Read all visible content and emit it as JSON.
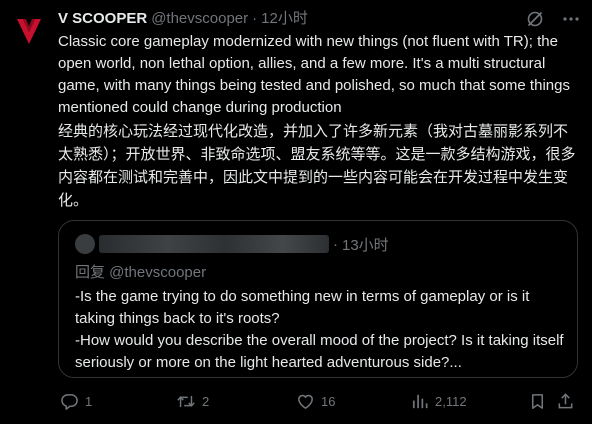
{
  "tweet": {
    "author_name": "V SCOOPER",
    "author_handle": "@thevscooper",
    "separator": "·",
    "timestamp": "12小时",
    "body_en": "Classic core gameplay modernized with new things (not fluent with TR); the open world, non lethal option, allies, and a few more. It's a multi structural game, with many things being tested and polished, so much that some things mentioned could change during production",
    "body_zh": "经典的核心玩法经过现代化改造，并加入了许多新元素（我对古墓丽影系列不太熟悉）；开放世界、非致命选项、盟友系统等等。这是一款多结构游戏，很多内容都在测试和完善中，因此文中提到的一些内容可能会在开发过程中发生变化。"
  },
  "quote": {
    "separator": "·",
    "timestamp": "13小时",
    "reply_to": "回复 @thevscooper",
    "body_line1": "-Is the game trying to do something new in terms of gameplay or is it taking things back to it's roots?",
    "body_line2": "-How would you describe the overall mood of the project? Is it taking itself seriously or more on the light hearted adventurous side?..."
  },
  "actions": {
    "reply_count": "1",
    "retweet_count": "2",
    "like_count": "16",
    "views_count": "2,112"
  },
  "icons": {
    "avatar": "red-chevron-logo",
    "header_left": "grok-slash-icon",
    "header_right": "more-options-icon",
    "reply": "reply-icon",
    "retweet": "retweet-icon",
    "like": "heart-icon",
    "views": "views-chart-icon",
    "bookmark": "bookmark-icon",
    "share": "share-icon"
  },
  "colors": {
    "background": "#000000",
    "text": "#e7e9ea",
    "muted": "#71767b",
    "border": "#2f3336",
    "logo_red": "#c8102e"
  }
}
